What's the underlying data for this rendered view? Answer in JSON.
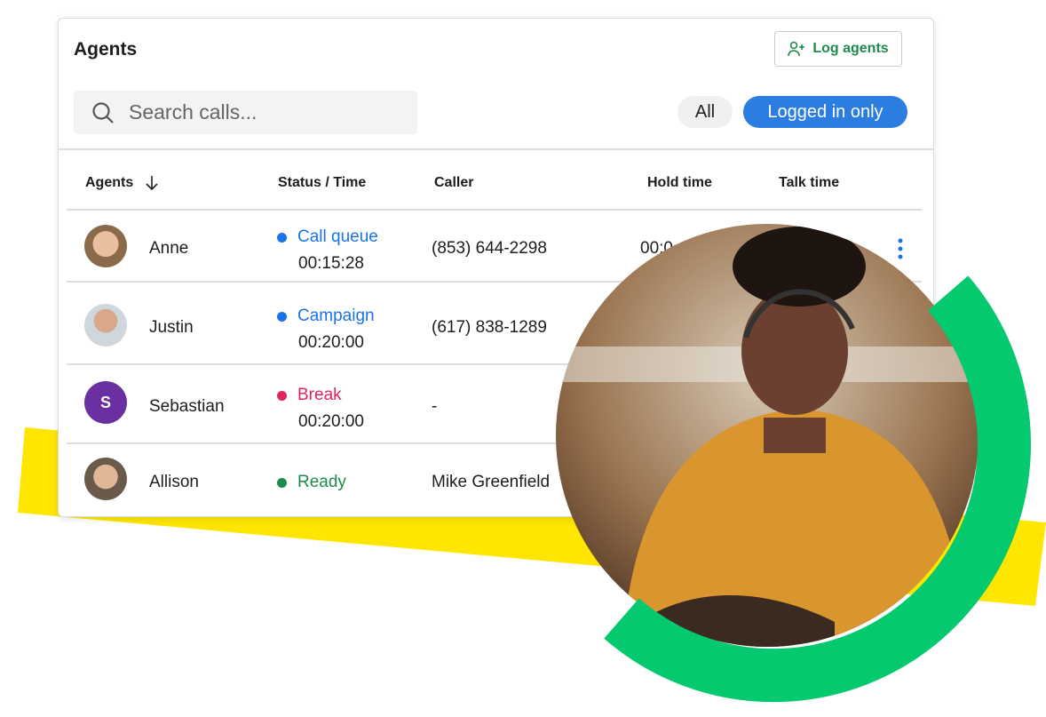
{
  "panel": {
    "title": "Agents",
    "log_agents_label": "Log agents",
    "search_placeholder": "Search calls...",
    "filters": [
      {
        "label": "All",
        "active": false
      },
      {
        "label": "Logged in only",
        "active": true
      }
    ],
    "accent_color": "#2b7de0"
  },
  "table": {
    "headers": [
      "Agents",
      "Status / Time",
      "Caller",
      "Hold time",
      "Talk time"
    ],
    "sort_icon": "arrow-down-icon",
    "rows": [
      {
        "name": "Anne",
        "status": "Call queue",
        "status_color": "#1a73e8",
        "time": "00:15:28",
        "caller": "(853) 644-2298",
        "hold": "00:0"
      },
      {
        "name": "Justin",
        "status": "Campaign",
        "status_color": "#1a73e8",
        "time": "00:20:00",
        "caller": "(617) 838-1289"
      },
      {
        "name": "Sebastian",
        "initial": "S",
        "status": "Break",
        "status_color": "#e0245e",
        "time": "00:20:00",
        "caller": "-"
      },
      {
        "name": "Allison",
        "status": "Ready",
        "status_color": "#1e8a4c",
        "caller": "Mike Greenfield"
      }
    ]
  }
}
